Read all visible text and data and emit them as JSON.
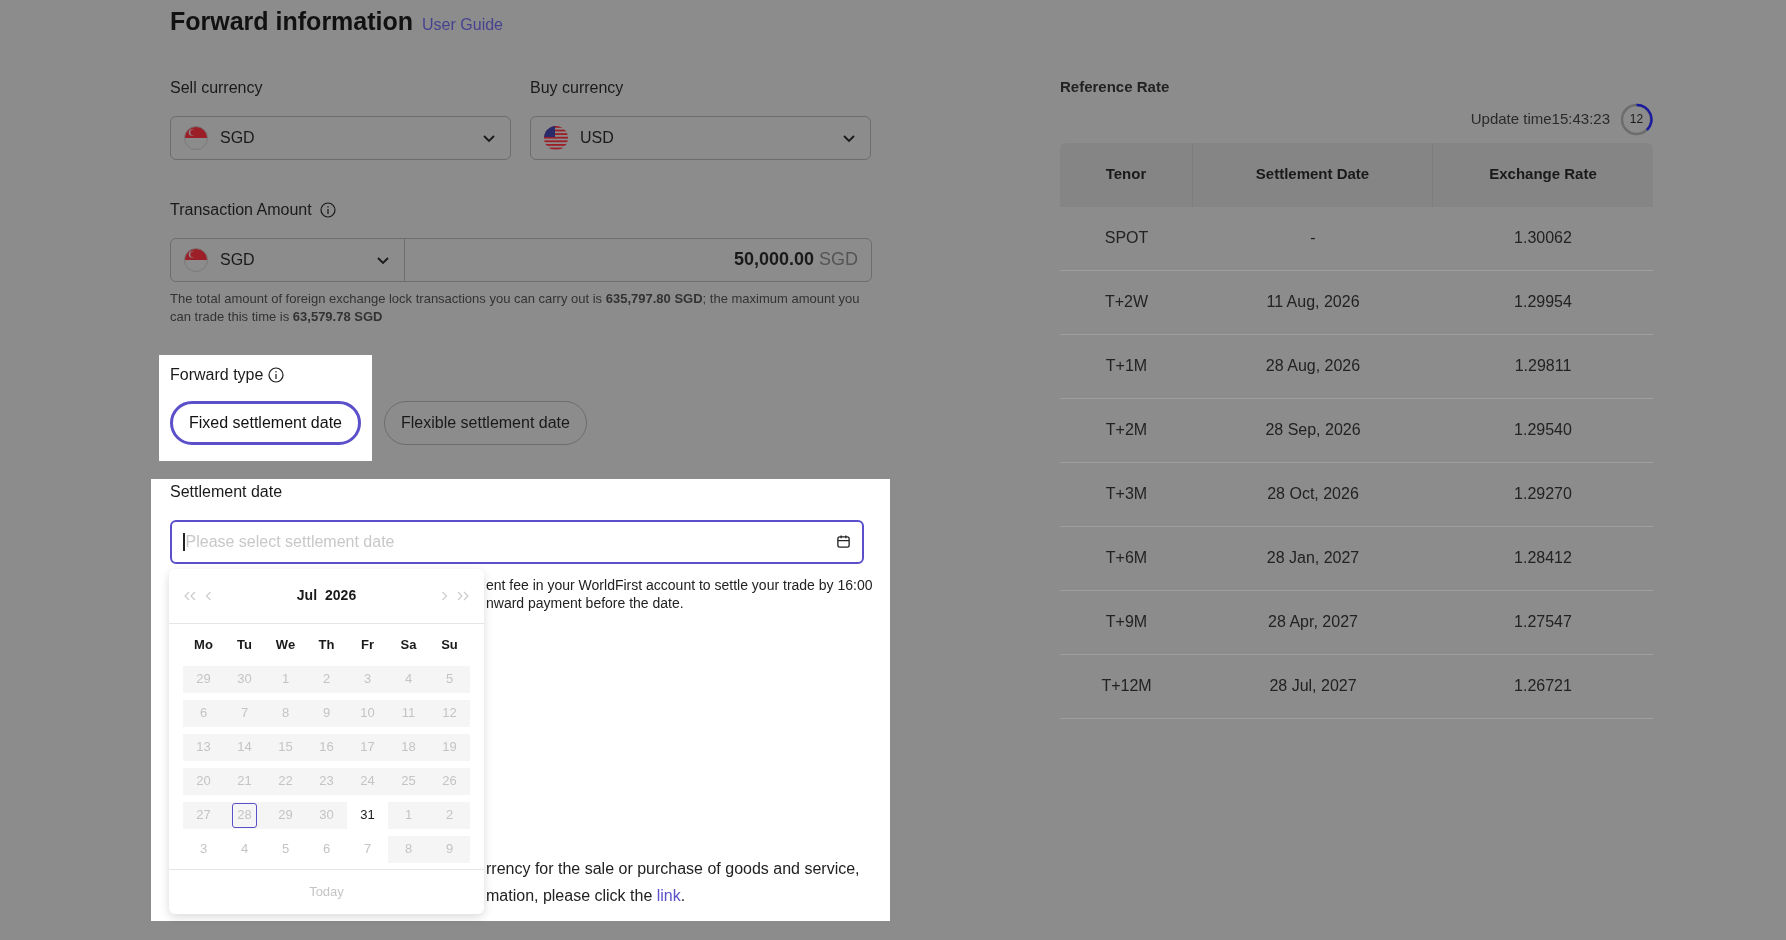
{
  "title": "Forward information",
  "user_guide": "User Guide",
  "sell": {
    "label": "Sell currency",
    "currency": "SGD",
    "kind": "sg"
  },
  "buy": {
    "label": "Buy currency",
    "currency": "USD",
    "kind": "us"
  },
  "amount": {
    "label": "Transaction Amount",
    "currency": "SGD",
    "kind": "sg",
    "value": "50,000.00",
    "unit": "SGD",
    "note": "The total amount of foreign exchange lock transactions you can carry out is **635,797.80 SGD**; the maximum amount you can trade this time is **63,579.78 SGD**"
  },
  "forward_type": {
    "label": "Forward type",
    "options": [
      {
        "label": "Fixed settlement date",
        "selected": true
      },
      {
        "label": "Flexible settlement date",
        "selected": false
      }
    ]
  },
  "settlement": {
    "label": "Settlement date",
    "placeholder": "Please select settlement date",
    "note_lines": [
      "ent fee in your WorldFirst account to settle your trade by 16:00",
      "nward payment before the date."
    ],
    "disclaimer_line": "rrency for the sale or purchase of goods and service,",
    "link_line": {
      "before": "mation, please click the ",
      "link": "link",
      "after": "."
    }
  },
  "calendar": {
    "month": "Jul",
    "year": "2026",
    "weekdays": [
      "Mo",
      "Tu",
      "We",
      "Th",
      "Fr",
      "Sa",
      "Su"
    ],
    "weeks": [
      [
        {
          "day": "29",
          "kind": "disabled",
          "today": false
        },
        {
          "day": "30",
          "kind": "disabled",
          "today": false
        },
        {
          "day": "1",
          "kind": "disabled",
          "today": false
        },
        {
          "day": "2",
          "kind": "disabled",
          "today": false
        },
        {
          "day": "3",
          "kind": "disabled",
          "today": false
        },
        {
          "day": "4",
          "kind": "disabled",
          "today": false
        },
        {
          "day": "5",
          "kind": "disabled",
          "today": false
        }
      ],
      [
        {
          "day": "6",
          "kind": "disabled",
          "today": false
        },
        {
          "day": "7",
          "kind": "disabled",
          "today": false
        },
        {
          "day": "8",
          "kind": "disabled",
          "today": false
        },
        {
          "day": "9",
          "kind": "disabled",
          "today": false
        },
        {
          "day": "10",
          "kind": "disabled",
          "today": false
        },
        {
          "day": "11",
          "kind": "disabled",
          "today": false
        },
        {
          "day": "12",
          "kind": "disabled",
          "today": false
        }
      ],
      [
        {
          "day": "13",
          "kind": "disabled",
          "today": false
        },
        {
          "day": "14",
          "kind": "disabled",
          "today": false
        },
        {
          "day": "15",
          "kind": "disabled",
          "today": false
        },
        {
          "day": "16",
          "kind": "disabled",
          "today": false
        },
        {
          "day": "17",
          "kind": "disabled",
          "today": false
        },
        {
          "day": "18",
          "kind": "disabled",
          "today": false
        },
        {
          "day": "19",
          "kind": "disabled",
          "today": false
        }
      ],
      [
        {
          "day": "20",
          "kind": "disabled",
          "today": false
        },
        {
          "day": "21",
          "kind": "disabled",
          "today": false
        },
        {
          "day": "22",
          "kind": "disabled",
          "today": false
        },
        {
          "day": "23",
          "kind": "disabled",
          "today": false
        },
        {
          "day": "24",
          "kind": "disabled",
          "today": false
        },
        {
          "day": "25",
          "kind": "disabled",
          "today": false
        },
        {
          "day": "26",
          "kind": "disabled",
          "today": false
        }
      ],
      [
        {
          "day": "27",
          "kind": "disabled",
          "today": false
        },
        {
          "day": "28",
          "kind": "disabled",
          "today": true
        },
        {
          "day": "29",
          "kind": "disabled",
          "today": false
        },
        {
          "day": "30",
          "kind": "disabled",
          "today": false
        },
        {
          "day": "31",
          "kind": "available",
          "today": false
        },
        {
          "day": "1",
          "kind": "disabled",
          "today": false
        },
        {
          "day": "2",
          "kind": "disabled",
          "today": false
        }
      ],
      [
        {
          "day": "3",
          "kind": "muted",
          "today": false
        },
        {
          "day": "4",
          "kind": "muted",
          "today": false
        },
        {
          "day": "5",
          "kind": "muted",
          "today": false
        },
        {
          "day": "6",
          "kind": "muted",
          "today": false
        },
        {
          "day": "7",
          "kind": "muted",
          "today": false
        },
        {
          "day": "8",
          "kind": "disabled",
          "today": false
        },
        {
          "day": "9",
          "kind": "disabled",
          "today": false
        }
      ]
    ],
    "today_button": "Today"
  },
  "reference": {
    "title": "Reference Rate",
    "update_label": "Update time15:43:23",
    "countdown": "12",
    "columns": [
      "Tenor",
      "Settlement Date",
      "Exchange Rate"
    ],
    "rows": [
      [
        "SPOT",
        "-",
        "1.30062"
      ],
      [
        "T+2W",
        "11 Aug, 2026",
        "1.29954"
      ],
      [
        "T+1M",
        "28 Aug, 2026",
        "1.29811"
      ],
      [
        "T+2M",
        "28 Sep, 2026",
        "1.29540"
      ],
      [
        "T+3M",
        "28 Oct, 2026",
        "1.29270"
      ],
      [
        "T+6M",
        "28 Jan, 2027",
        "1.28412"
      ],
      [
        "T+9M",
        "28 Apr, 2027",
        "1.27547"
      ],
      [
        "T+12M",
        "28 Jul, 2027",
        "1.26721"
      ]
    ]
  }
}
